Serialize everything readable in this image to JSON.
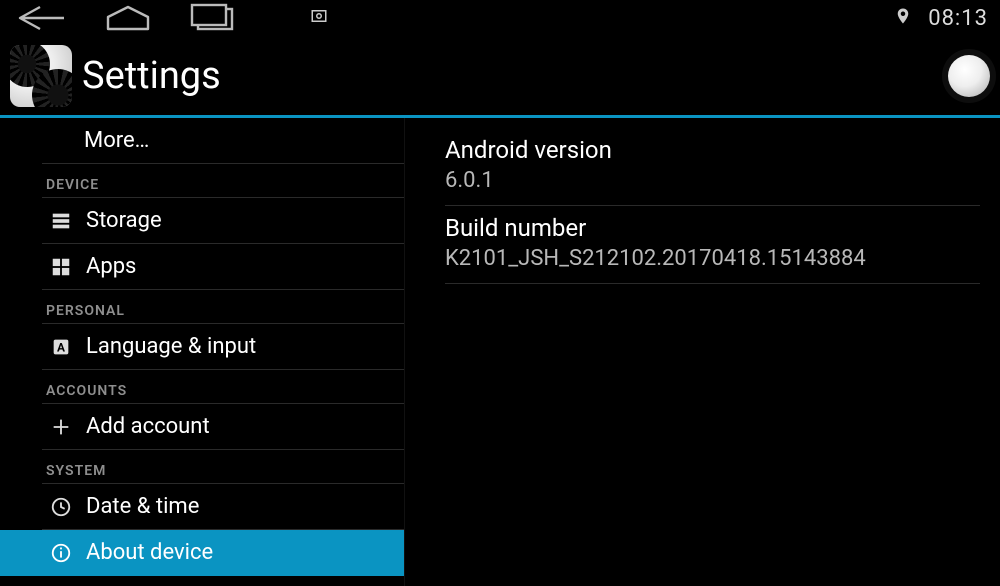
{
  "status": {
    "clock": "08:13"
  },
  "app_title": "Settings",
  "sidebar": {
    "more_label": "More…",
    "sections": {
      "device": {
        "header": "DEVICE",
        "storage": "Storage",
        "apps": "Apps"
      },
      "personal": {
        "header": "PERSONAL",
        "language_input": "Language & input"
      },
      "accounts": {
        "header": "ACCOUNTS",
        "add_account": "Add account"
      },
      "system": {
        "header": "SYSTEM",
        "date_time": "Date & time",
        "about_device": "About device"
      }
    }
  },
  "about": {
    "android_version_label": "Android version",
    "android_version_value": "6.0.1",
    "build_number_label": "Build number",
    "build_number_value": "K2101_JSH_S212102.20170418.15143884"
  }
}
